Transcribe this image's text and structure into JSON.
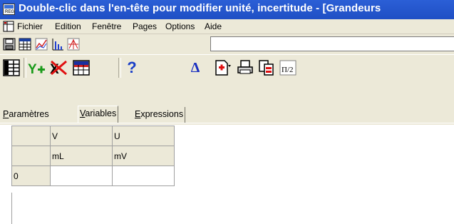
{
  "window": {
    "title": "Double-clic dans l'en-tête pour modifier unité, incertitude - [Grandeurs",
    "colors": {
      "title_bg": "#2455cc",
      "face": "#ece9d8"
    }
  },
  "menu": {
    "items": [
      "Fichier",
      "Edition",
      "Fenêtre",
      "Pages",
      "Options",
      "Aide"
    ]
  },
  "toolbar1": {
    "icons": [
      "save-icon",
      "table-view-icon",
      "line-graph-icon",
      "bar-graph-icon",
      "diagram-icon"
    ],
    "edit_value": ""
  },
  "toolbar2": {
    "icons": [
      "variables-list-icon",
      "add-y-icon",
      "delete-x-icon",
      "grid-table-icon",
      "help-icon",
      "delta-icon",
      "new-page-icon",
      "print-icon",
      "copy-page-icon",
      "pi-half-icon"
    ],
    "help_glyph": "?",
    "delta_glyph": "Δ"
  },
  "tabs": [
    {
      "label": "Paramètres",
      "active": false
    },
    {
      "label": "Variables",
      "active": true
    },
    {
      "label": "Expressions",
      "active": false
    }
  ],
  "table": {
    "columns": [
      {
        "name": "V",
        "unit": "mL"
      },
      {
        "name": "U",
        "unit": "mV"
      }
    ],
    "rows": [
      {
        "index": "0",
        "values": [
          "",
          ""
        ]
      }
    ]
  }
}
